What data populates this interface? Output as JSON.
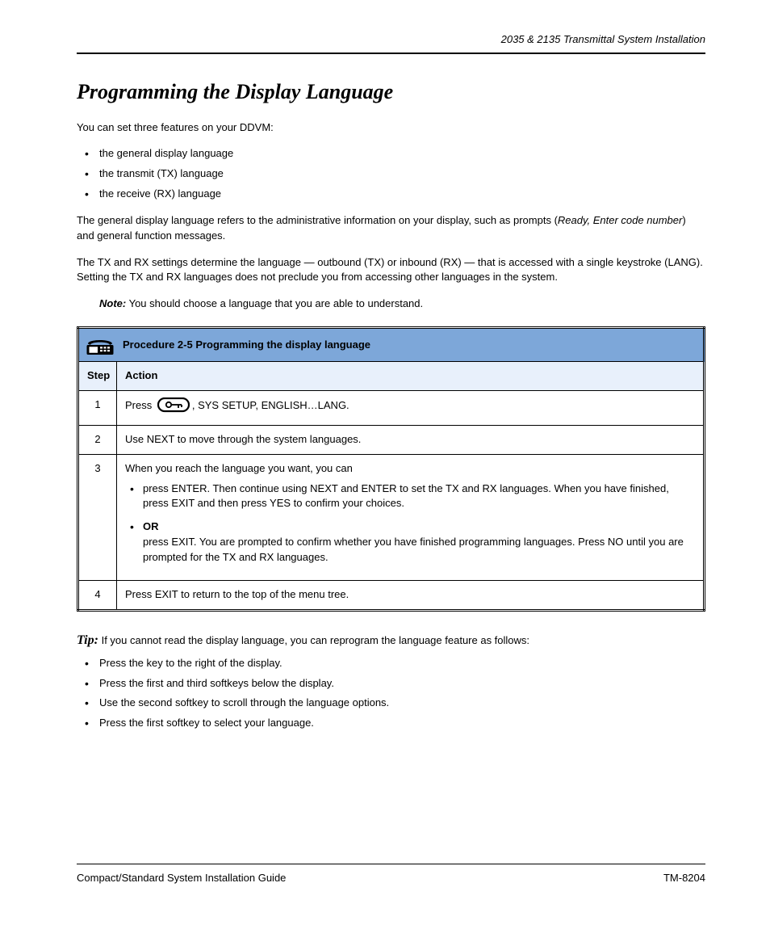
{
  "header": {
    "running": "2035 & 2135 Transmittal  System Installation"
  },
  "h1": "Programming the Display Language",
  "para1": "You can set three features on your DDVM:",
  "bullets_top": [
    "the general display language",
    "the transmit (TX) language",
    "the receive (RX) language"
  ],
  "para2_a": "The general display language refers to the administrative information on your display, such as prompts (",
  "para2_i": "Ready, Enter code number",
  "para2_b": ") and general function messages.",
  "para3": "The TX and RX settings determine the language — outbound (TX) or inbound (RX) — that is accessed with a single keystroke (LANG). Setting the TX and RX languages does not preclude you from accessing other languages in the system.",
  "note_label": "Note:",
  "note_text": " You should choose a language that you are able to understand.",
  "proc": {
    "title": "Procedure 2-5  Programming the display language",
    "subhead": {
      "step": "Step",
      "action": "Action"
    },
    "rows": [
      {
        "num": "1",
        "prefix": "Press ",
        "suffix": ", SYS SETUP, ENGLISH…LANG."
      },
      {
        "num": "2",
        "text": "Use NEXT to move through the system languages."
      },
      {
        "num": "3",
        "intro": "When you reach the language you want, you can",
        "opts": [
          {
            "pre": "press ENTER. Then continue using NEXT and ENTER to set the TX and RX languages. When you have finished, press EXIT and then press YES to confirm your choices."
          },
          {
            "or": "OR",
            "pre": "press EXIT. You are prompted to confirm whether you have finished programming languages. Press NO until you are prompted for the TX and RX languages."
          }
        ]
      },
      {
        "num": "4",
        "text": "Press EXIT to return to the top of the menu tree."
      }
    ]
  },
  "tip_label": "Tip:",
  "tip_text": " If you cannot read the display language, you can reprogram the language feature as follows:",
  "tip_list": [
    "Press the key to the right of the display.",
    "Press the first and third softkeys below the display.",
    "Use the second softkey to scroll through the language options.",
    "Press the first softkey to select your language."
  ],
  "footer": {
    "left": "Compact/Standard  System Installation Guide",
    "right": "TM-8204"
  }
}
